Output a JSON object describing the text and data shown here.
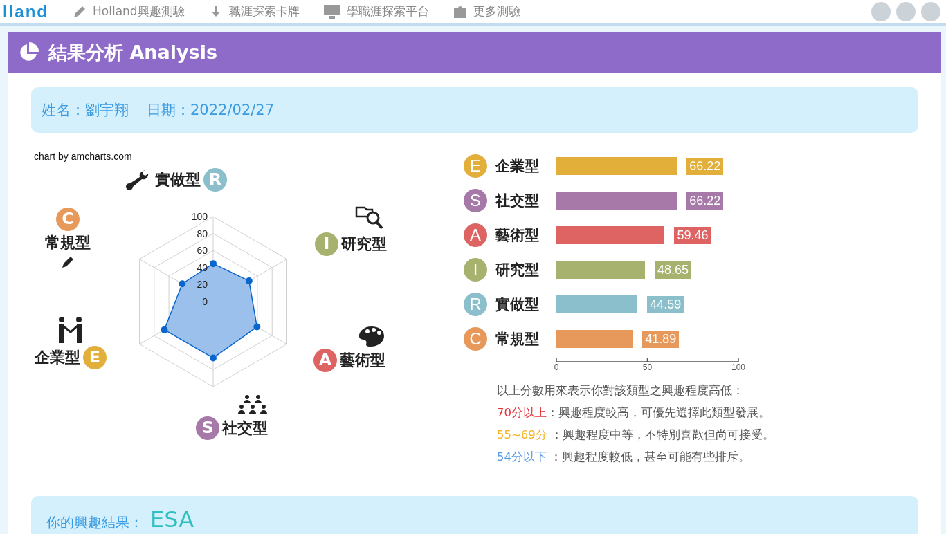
{
  "nav": {
    "logo": "lland",
    "items": [
      {
        "label": "Holland興趣測驗"
      },
      {
        "label": "職涯探索卡牌"
      },
      {
        "label": "學職涯探索平台"
      },
      {
        "label": "更多測驗"
      }
    ]
  },
  "header": {
    "title": "結果分析 Analysis"
  },
  "info": {
    "name": "姓名：劉宇翔",
    "date": "日期：2022/02/27"
  },
  "radar": {
    "credit": "chart by amcharts.com",
    "axes": [
      {
        "letter": "R",
        "label": "實做型",
        "color": "#8bbfcc"
      },
      {
        "letter": "I",
        "label": "研究型",
        "color": "#a7b26e"
      },
      {
        "letter": "A",
        "label": "藝術型",
        "color": "#de6464"
      },
      {
        "letter": "S",
        "label": "社交型",
        "color": "#a679a8"
      },
      {
        "letter": "E",
        "label": "企業型",
        "color": "#e2b03a"
      },
      {
        "letter": "C",
        "label": "常規型",
        "color": "#e6995a"
      }
    ],
    "scale_labels": [
      "100",
      "80",
      "60",
      "40",
      "20",
      "0"
    ]
  },
  "bars": {
    "badges": [
      {
        "letter": "E",
        "color": "#e2b03a"
      },
      {
        "letter": "S",
        "color": "#a679a8"
      },
      {
        "letter": "A",
        "color": "#de6464"
      },
      {
        "letter": "I",
        "color": "#a7b26e"
      },
      {
        "letter": "R",
        "color": "#8bbfcc"
      },
      {
        "letter": "C",
        "color": "#e6995a"
      }
    ],
    "chart_data": {
      "type": "bar",
      "orientation": "horizontal",
      "categories": [
        "企業型",
        "社交型",
        "藝術型",
        "研究型",
        "實做型",
        "常規型"
      ],
      "values": [
        66.22,
        66.22,
        59.46,
        48.65,
        44.59,
        41.89
      ],
      "xlim": [
        0,
        100
      ],
      "xticks": [
        0,
        50,
        100
      ],
      "data_labels": true
    }
  },
  "legend": {
    "intro": "以上分數用來表示你對該類型之興趣程度高低：",
    "items": [
      {
        "range": "70分以上",
        "text": "：興趣程度較高，可優先選擇此類型發展。",
        "color": "#e8323c"
      },
      {
        "range": "55~69分",
        "text": " ：興趣程度中等，不特別喜歡但尚可接受。",
        "color": "#f5b21e"
      },
      {
        "range": "54分以下",
        "text": " ：興趣程度較低，甚至可能有些排斥。",
        "color": "#5b9be0"
      }
    ]
  },
  "result": {
    "label": "你的興趣結果：",
    "value": "ESA"
  }
}
